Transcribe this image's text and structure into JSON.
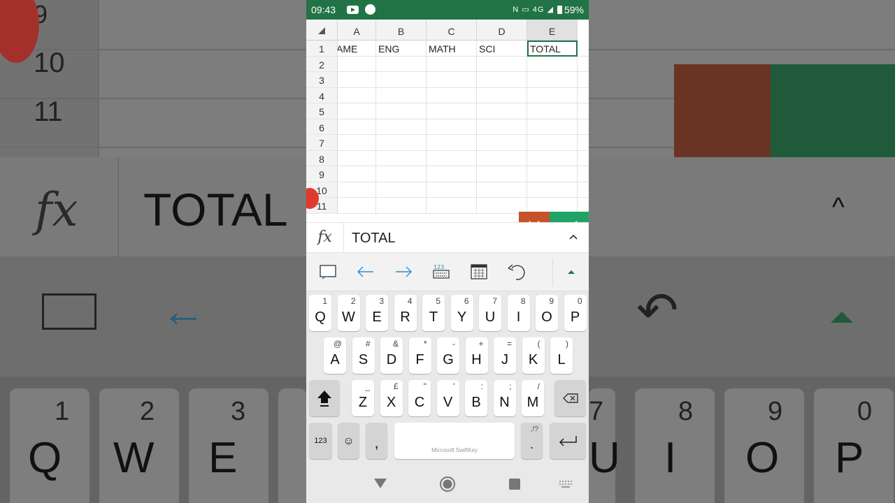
{
  "status_bar": {
    "time": "09:43",
    "network": "4G",
    "battery": "59%"
  },
  "spreadsheet": {
    "columns": [
      "A",
      "B",
      "C",
      "D",
      "E"
    ],
    "rows": [
      "1",
      "2",
      "3",
      "4",
      "5",
      "6",
      "7",
      "8",
      "9",
      "10",
      "11"
    ],
    "row1_cells": [
      "AME",
      "ENG",
      "MATH",
      "SCI",
      "TOTAL"
    ],
    "active_cell": "E1"
  },
  "formula_bar": {
    "fx_label": "fx",
    "value": "TOTAL"
  },
  "toolbar": {
    "icons": [
      "select-cells-icon",
      "arrow-left-icon",
      "arrow-right-icon",
      "numeric-keyboard-icon",
      "calendar-icon",
      "undo-icon",
      "expand-up-icon"
    ]
  },
  "keyboard": {
    "row1": [
      {
        "key": "Q",
        "alt": "1"
      },
      {
        "key": "W",
        "alt": "2"
      },
      {
        "key": "E",
        "alt": "3"
      },
      {
        "key": "R",
        "alt": "4"
      },
      {
        "key": "T",
        "alt": "5"
      },
      {
        "key": "Y",
        "alt": "6"
      },
      {
        "key": "U",
        "alt": "7"
      },
      {
        "key": "I",
        "alt": "8"
      },
      {
        "key": "O",
        "alt": "9"
      },
      {
        "key": "P",
        "alt": "0"
      }
    ],
    "row2": [
      {
        "key": "A",
        "alt": "@"
      },
      {
        "key": "S",
        "alt": "#"
      },
      {
        "key": "D",
        "alt": "&"
      },
      {
        "key": "F",
        "alt": "*"
      },
      {
        "key": "G",
        "alt": "-"
      },
      {
        "key": "H",
        "alt": "+"
      },
      {
        "key": "J",
        "alt": "="
      },
      {
        "key": "K",
        "alt": "("
      },
      {
        "key": "L",
        "alt": ")"
      }
    ],
    "row3": [
      {
        "key": "Z",
        "alt": "_"
      },
      {
        "key": "X",
        "alt": "£"
      },
      {
        "key": "C",
        "alt": "\""
      },
      {
        "key": "V",
        "alt": "'"
      },
      {
        "key": "B",
        "alt": ":"
      },
      {
        "key": "N",
        "alt": ";"
      },
      {
        "key": "M",
        "alt": "/"
      }
    ],
    "numbers_label": "123",
    "comma": ",",
    "period": ".",
    "period_alt": ",!?",
    "space_label": "Microsoft SwiftKey"
  },
  "colors": {
    "excel_green": "#217346",
    "confirm_green": "#21a366",
    "cancel_orange": "#c7522a"
  }
}
